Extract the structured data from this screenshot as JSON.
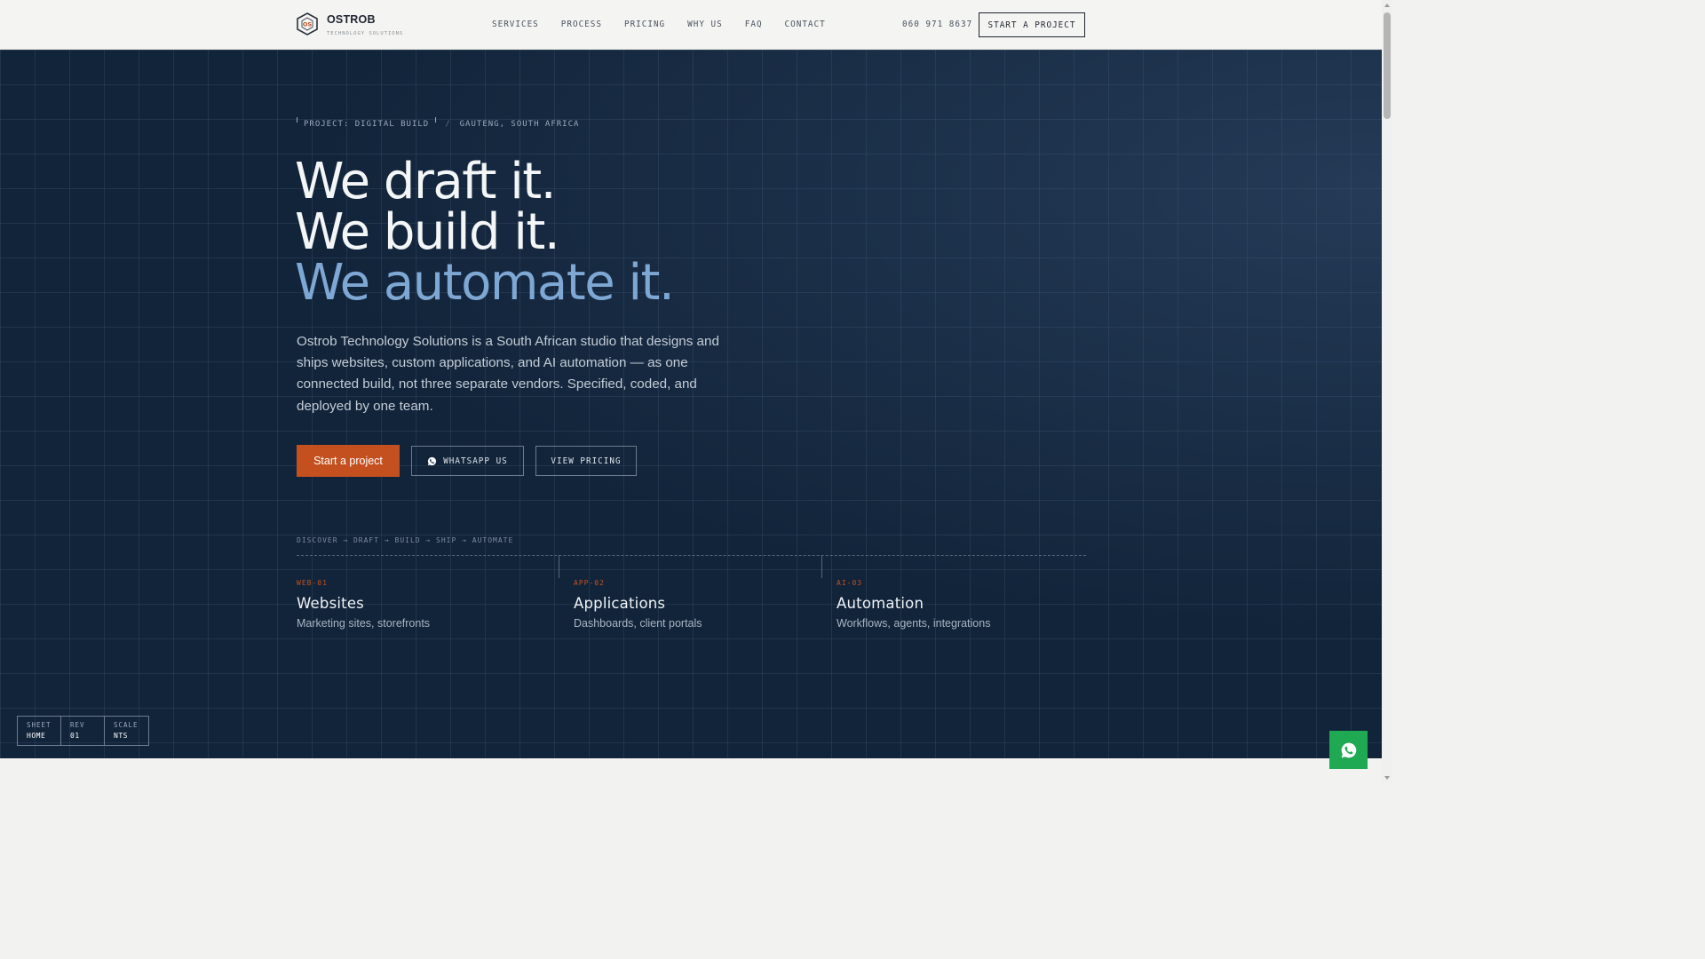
{
  "header": {
    "brand_name": "OSTROB",
    "brand_sub": "TECHNOLOGY SOLUTIONS",
    "nav": [
      "SERVICES",
      "PROCESS",
      "PRICING",
      "WHY US",
      "FAQ",
      "CONTACT"
    ],
    "phone": "060 971 8637",
    "cta_label": "START A PROJECT"
  },
  "hero": {
    "tag_project": "PROJECT: DIGITAL BUILD",
    "tag_sep": "/",
    "tag_location": "GAUTENG, SOUTH AFRICA",
    "headline_1": "We draft it.",
    "headline_2": "We build it.",
    "headline_3": "We automate it.",
    "description": "Ostrob Technology Solutions is a South African studio that designs and ships websites, custom applications, and AI automation — as one connected build, not three separate vendors. Specified, coded, and deployed by one team.",
    "btn_primary": "Start a project",
    "btn_whatsapp": "WHATSAPP US",
    "btn_pricing": "VIEW PRICING",
    "process": "DISCOVER → DRAFT → BUILD → SHIP → AUTOMATE"
  },
  "services": [
    {
      "code": "WEB-01",
      "title": "Websites",
      "subtitle": "Marketing sites, storefronts"
    },
    {
      "code": "APP-02",
      "title": "Applications",
      "subtitle": "Dashboards, client portals"
    },
    {
      "code": "AI-03",
      "title": "Automation",
      "subtitle": "Workflows, agents, integrations"
    }
  ],
  "titleblock": [
    {
      "label": "SHEET",
      "value": "HOME"
    },
    {
      "label": "REV",
      "value": "01"
    },
    {
      "label": "SCALE",
      "value": "NTS"
    }
  ],
  "colors": {
    "accent": "#c4501f",
    "hero_bg": "#12243a",
    "headline_accent": "#7ea7d4",
    "whatsapp": "#1ea952"
  },
  "icons": {
    "logo": "hexagon-os-logo-icon",
    "whatsapp": "whatsapp-icon"
  }
}
